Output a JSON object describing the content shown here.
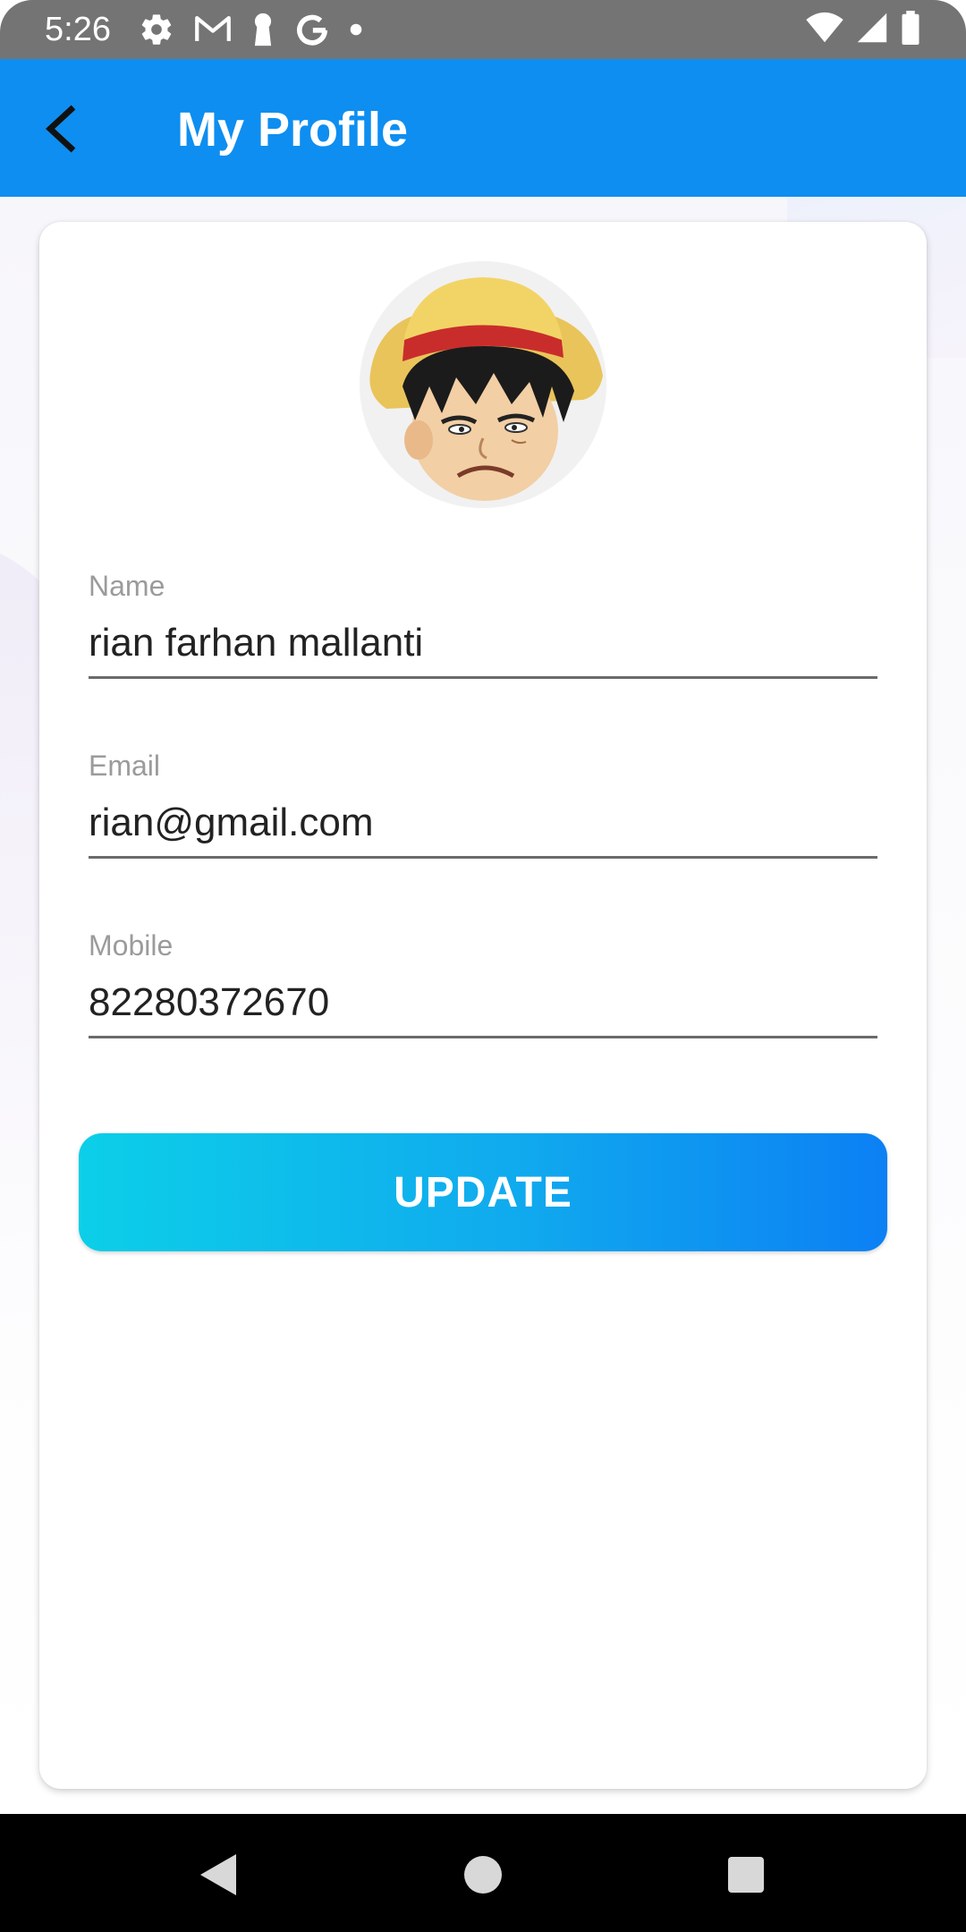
{
  "status_bar": {
    "time": "5:26",
    "left_icons": [
      "settings-icon",
      "gmail-icon",
      "keyhole-icon",
      "google-icon",
      "dot-icon"
    ],
    "right_icons": [
      "wifi-icon",
      "cellular-icon",
      "battery-icon"
    ]
  },
  "app_bar": {
    "title": "My Profile",
    "back_icon": "chevron-left-icon",
    "background": "#0e8ef0"
  },
  "profile": {
    "avatar": "profile-avatar-straw-hat-character",
    "fields": {
      "name": {
        "label": "Name",
        "value": "rian farhan mallanti"
      },
      "email": {
        "label": "Email",
        "value": "rian@gmail.com"
      },
      "mobile": {
        "label": "Mobile",
        "value": "82280372670"
      }
    },
    "update_button": {
      "label": "UPDATE",
      "gradient_start": "#0ccfe8",
      "gradient_end": "#0c80f4"
    }
  },
  "nav_bar": {
    "buttons": [
      "back-triangle-icon",
      "home-circle-icon",
      "recents-square-icon"
    ]
  }
}
